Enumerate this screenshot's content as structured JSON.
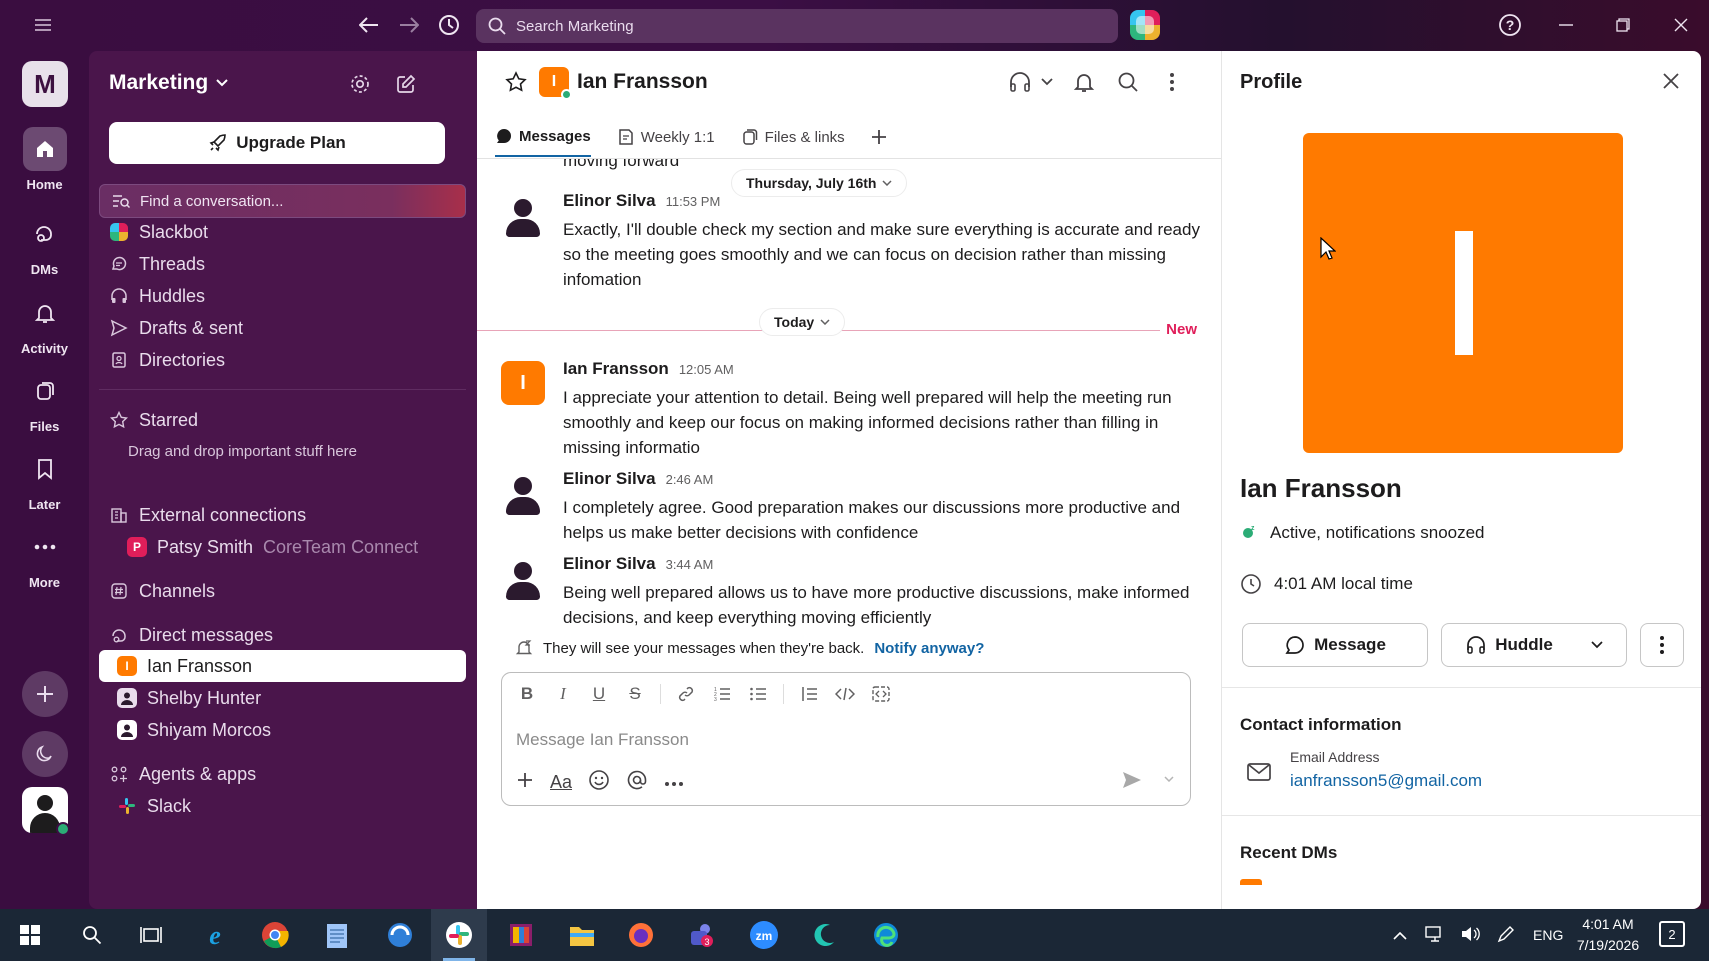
{
  "titlebar": {
    "search_placeholder": "Search Marketing"
  },
  "rail": {
    "workspace_initial": "M",
    "items": [
      {
        "label": "Home"
      },
      {
        "label": "DMs"
      },
      {
        "label": "Activity"
      },
      {
        "label": "Files"
      },
      {
        "label": "Later"
      },
      {
        "label": "More"
      }
    ]
  },
  "sidebar": {
    "workspace": "Marketing",
    "upgrade_label": "Upgrade Plan",
    "find_placeholder": "Find a conversation...",
    "nav": [
      "Slackbot",
      "Threads",
      "Huddles",
      "Drafts & sent",
      "Directories"
    ],
    "starred": {
      "label": "Starred",
      "hint": "Drag and drop important stuff here"
    },
    "external": {
      "label": "External connections",
      "person": "Patsy Smith",
      "org": "CoreTeam Connect"
    },
    "channels_label": "Channels",
    "dm_label": "Direct messages",
    "dms": [
      "Ian Fransson",
      "Shelby Hunter",
      "Shiyam Morcos"
    ],
    "agents_label": "Agents & apps",
    "apps": [
      "Slack"
    ]
  },
  "chat": {
    "title": "Ian Fransson",
    "avatar_initial": "I",
    "tabs": [
      "Messages",
      "Weekly 1:1",
      "Files & links"
    ],
    "partial_text": "moving forward",
    "date_1": "Thursday, July 16th",
    "date_2": "Today",
    "new_label": "New",
    "messages": [
      {
        "author": "Elinor Silva",
        "time": "11:53 PM",
        "text": "Exactly, I'll double check my section and make sure everything is accurate and ready so the meeting goes smoothly and we can focus on decision rather than missing infomation"
      },
      {
        "author": "Ian Fransson",
        "time": "12:05 AM",
        "text": "I appreciate your attention to detail. Being well prepared will help the meeting run smoothly and keep our focus on making informed decisions rather than filling in missing informatio"
      },
      {
        "author": "Elinor Silva",
        "time": "2:46 AM",
        "text": "I completely agree. Good preparation makes our discussions more productive and helps us make better decisions with confidence"
      },
      {
        "author": "Elinor Silva",
        "time": "3:44 AM",
        "text": "Being well prepared allows us to have more productive discussions, make informed decisions, and keep everything moving efficiently"
      }
    ],
    "notice_text": "They will see your messages when they're back.",
    "notice_link": "Notify anyway?",
    "composer_placeholder": "Message Ian Fransson"
  },
  "profile": {
    "title": "Profile",
    "name": "Ian Fransson",
    "status": "Active, notifications snoozed",
    "local_time": "4:01 AM local time",
    "message_btn": "Message",
    "huddle_btn": "Huddle",
    "contact_heading": "Contact information",
    "email_label": "Email Address",
    "email": "ianfransson5@gmail.com",
    "recent_heading": "Recent DMs"
  },
  "taskbar": {
    "lang": "ENG",
    "time": "4:01 AM",
    "date": "7/19/2026",
    "notifications": "2"
  },
  "colors": {
    "sidebar_bg": "#4a154b",
    "accent_orange": "#ff7a00",
    "link_blue": "#1264a3",
    "new_red": "#e01e5a",
    "presence_green": "#2bac76"
  }
}
